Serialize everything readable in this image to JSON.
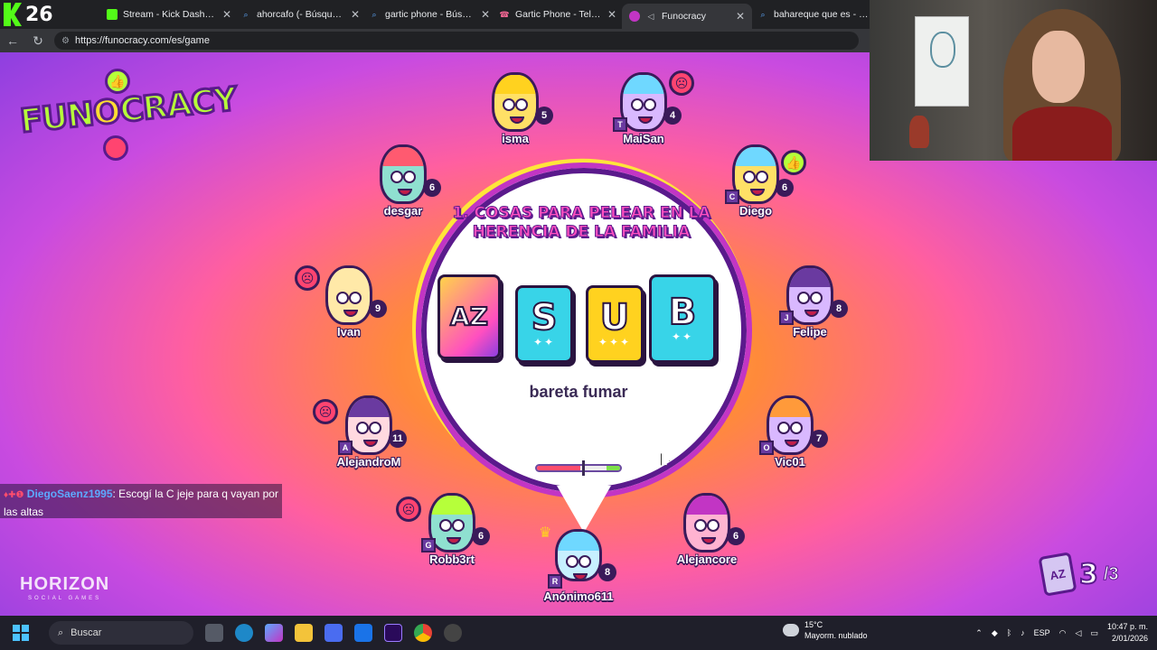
{
  "browser": {
    "kick_count": "26",
    "tabs": [
      {
        "title": "Stream - Kick Dashboard",
        "color": "#53fc18"
      },
      {
        "title": "ahorcafo (- Búsqueda",
        "color": "#5da9ff"
      },
      {
        "title": "gartic phone - Búsqueda",
        "color": "#5da9ff"
      },
      {
        "title": "Gartic Phone - Teléfono D",
        "color": "#ff6b9a"
      },
      {
        "title": "Funocracy",
        "color": "#c235c4"
      },
      {
        "title": "bahareque que es - Búsq",
        "color": "#5da9ff"
      }
    ],
    "url": "https://funocracy.com/es/game"
  },
  "game": {
    "logo": "FUNOCRACY",
    "question": "1. COSAS PARA PELEAR EN LA HERENCIA DE LA FAMILIA",
    "tiles": [
      {
        "letter": "AZ",
        "stars": ""
      },
      {
        "letter": "S",
        "stars": "✦✦"
      },
      {
        "letter": "U",
        "stars": "✦✦✦"
      },
      {
        "letter": "B",
        "stars": "✦✦"
      }
    ],
    "answer": "bareta fumar",
    "timer_fraction": 0.52,
    "round_current": "3",
    "round_total": "/3",
    "round_card": "AZ",
    "brand": "HORIZON",
    "brand_sub": "SOCIAL GAMES",
    "players": [
      {
        "name": "isma",
        "score": "5"
      },
      {
        "name": "MaiSan",
        "score": "4",
        "badge": "T"
      },
      {
        "name": "desgar",
        "score": "6"
      },
      {
        "name": "Diego",
        "score": "6",
        "badge": "C"
      },
      {
        "name": "Ivan",
        "score": "9"
      },
      {
        "name": "Felipe",
        "score": "8",
        "badge": "J"
      },
      {
        "name": "AlejandroM",
        "score": "11",
        "badge": "A"
      },
      {
        "name": "Vic01",
        "score": "7",
        "badge": "O"
      },
      {
        "name": "Robb3rt",
        "score": "6",
        "badge": "G"
      },
      {
        "name": "Anónimo611",
        "score": "8",
        "badge": "R"
      },
      {
        "name": "Alejancore",
        "score": "6"
      }
    ]
  },
  "chat": {
    "user": "DiegoSaenz1995",
    "message": ": Escogí la C jeje para q vayan por las altas"
  },
  "taskbar": {
    "search_placeholder": "Buscar",
    "weather_temp": "15°C",
    "weather_desc": "Mayorm. nublado",
    "lang": "ESP",
    "time": "10:47 p. m.",
    "date": "2/01/2026"
  }
}
